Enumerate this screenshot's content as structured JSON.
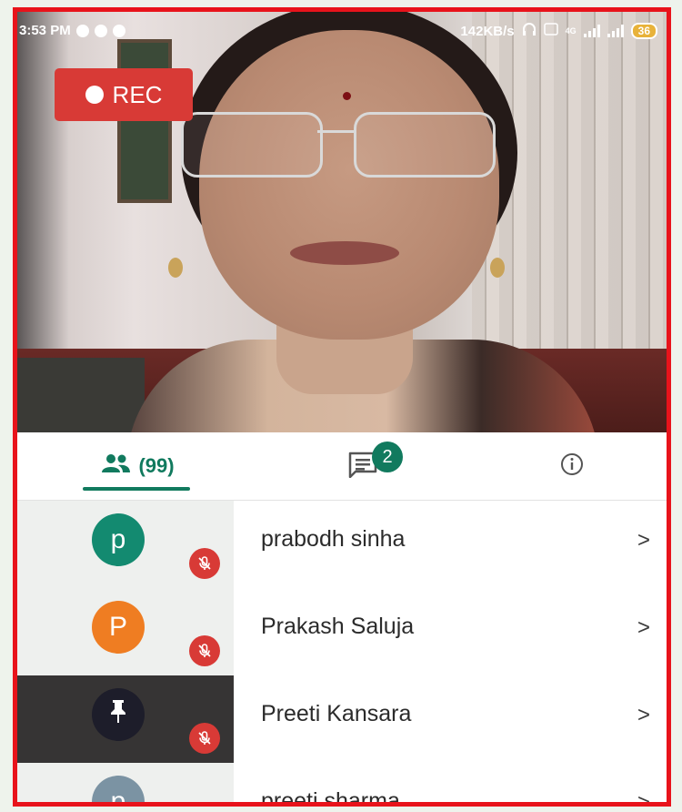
{
  "status_bar": {
    "time": "3:53 PM",
    "speed": "142KB/s",
    "network": "4G",
    "battery": "36"
  },
  "recording": {
    "label": "REC",
    "color": "#d83a36"
  },
  "tabs": {
    "people": {
      "icon": "people-icon",
      "count_label": "(99)"
    },
    "chat": {
      "icon": "chat-icon",
      "badge": "2"
    },
    "info": {
      "icon": "info-icon"
    }
  },
  "accent_color": "#117a5e",
  "participants": [
    {
      "initial": "p",
      "name": "prabodh sinha",
      "avatar_color": "#138a70",
      "muted": true,
      "icon": "mic-off-icon"
    },
    {
      "initial": "P",
      "name": "Prakash Saluja",
      "avatar_color": "#ef7d22",
      "muted": true,
      "icon": "mic-off-icon"
    },
    {
      "initial": "",
      "name": "Preeti Kansara",
      "avatar_color": "#1d1d2a",
      "muted": true,
      "pinned": true,
      "icon": "pin-icon"
    },
    {
      "initial": "p",
      "name": "preeti sharma",
      "avatar_color": "#7b93a3",
      "muted": true,
      "icon": "mic-off-icon"
    }
  ],
  "chevron": ">"
}
